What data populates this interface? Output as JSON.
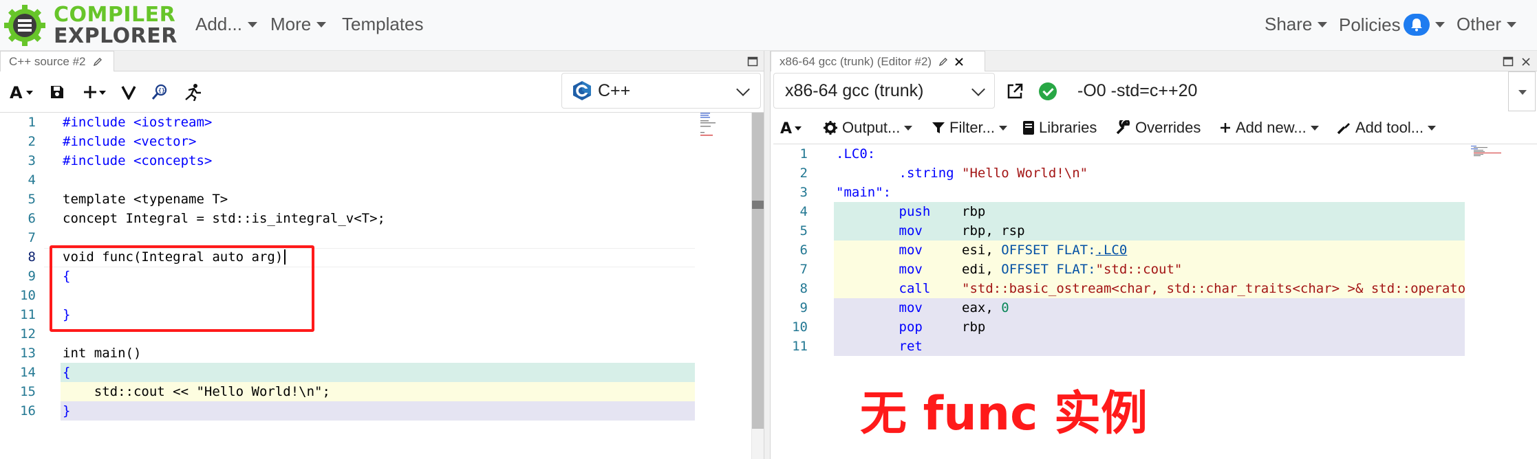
{
  "navbar": {
    "logo_line1": "COMPILER",
    "logo_line2": "EXPLORER",
    "add_label": "Add...",
    "more_label": "More",
    "templates_label": "Templates",
    "share_label": "Share",
    "policies_label": "Policies",
    "other_label": "Other"
  },
  "left_pane": {
    "tab_title": "C++ source #2",
    "language": "C++",
    "lines": [
      {
        "n": "1"
      },
      {
        "n": "2"
      },
      {
        "n": "3"
      },
      {
        "n": "4"
      },
      {
        "n": "5"
      },
      {
        "n": "6"
      },
      {
        "n": "7"
      },
      {
        "n": "8"
      },
      {
        "n": "9"
      },
      {
        "n": "10"
      },
      {
        "n": "11"
      },
      {
        "n": "12"
      },
      {
        "n": "13"
      },
      {
        "n": "14"
      },
      {
        "n": "15"
      },
      {
        "n": "16"
      }
    ],
    "code": {
      "l1": "#include <iostream>",
      "l2": "#include <vector>",
      "l3": "#include <concepts>",
      "l5": "template <typename T>",
      "l6": "concept Integral = std::is_integral_v<T>;",
      "l8": "void func(Integral auto arg)",
      "l9": "{",
      "l11": "}",
      "l13": "int main()",
      "l14": "{",
      "l15": "    std::cout << \"Hello World!\\n\";",
      "l16": "}"
    }
  },
  "right_pane": {
    "tab_title": "x86-64 gcc (trunk) (Editor #2)",
    "compiler": "x86-64 gcc (trunk)",
    "options": "-O0 -std=c++20",
    "toolbar": {
      "output": "Output...",
      "filter": "Filter...",
      "libraries": "Libraries",
      "overrides": "Overrides",
      "add_new": "Add new...",
      "add_tool": "Add tool..."
    },
    "asm": {
      "l1": ".LC0:",
      "l2_dir": ".string",
      "l2_str": "\"Hello World!\\n\"",
      "l3": "\"main\":",
      "l4_ins": "push",
      "l4_op": "rbp",
      "l5_ins": "mov",
      "l5_op": "rbp, rsp",
      "l6_ins": "mov",
      "l6_op1": "esi, ",
      "l6_kw": "OFFSET FLAT:",
      "l6_link": ".LC0",
      "l7_ins": "mov",
      "l7_op1": "edi, ",
      "l7_kw": "OFFSET FLAT:",
      "l7_str": "\"std::cout\"",
      "l8_ins": "call",
      "l8_str": "\"std::basic_ostream<char, std::char_traits<char> >& std::operato",
      "l9_ins": "mov",
      "l9_op": "eax, ",
      "l9_num": "0",
      "l10_ins": "pop",
      "l10_op": "rbp",
      "l11_ins": "ret"
    },
    "asm_line_numbers": [
      "1",
      "2",
      "3",
      "4",
      "5",
      "6",
      "7",
      "8",
      "9",
      "10",
      "11"
    ]
  },
  "annotation": {
    "caption": "无 func 实例"
  },
  "colors": {
    "highlight_green": "#d7efe8",
    "highlight_yellow": "#fdfde0",
    "highlight_purple": "#e5e4f2",
    "annotation_red": "#ff1a1a",
    "logo_green": "#67c52a"
  }
}
